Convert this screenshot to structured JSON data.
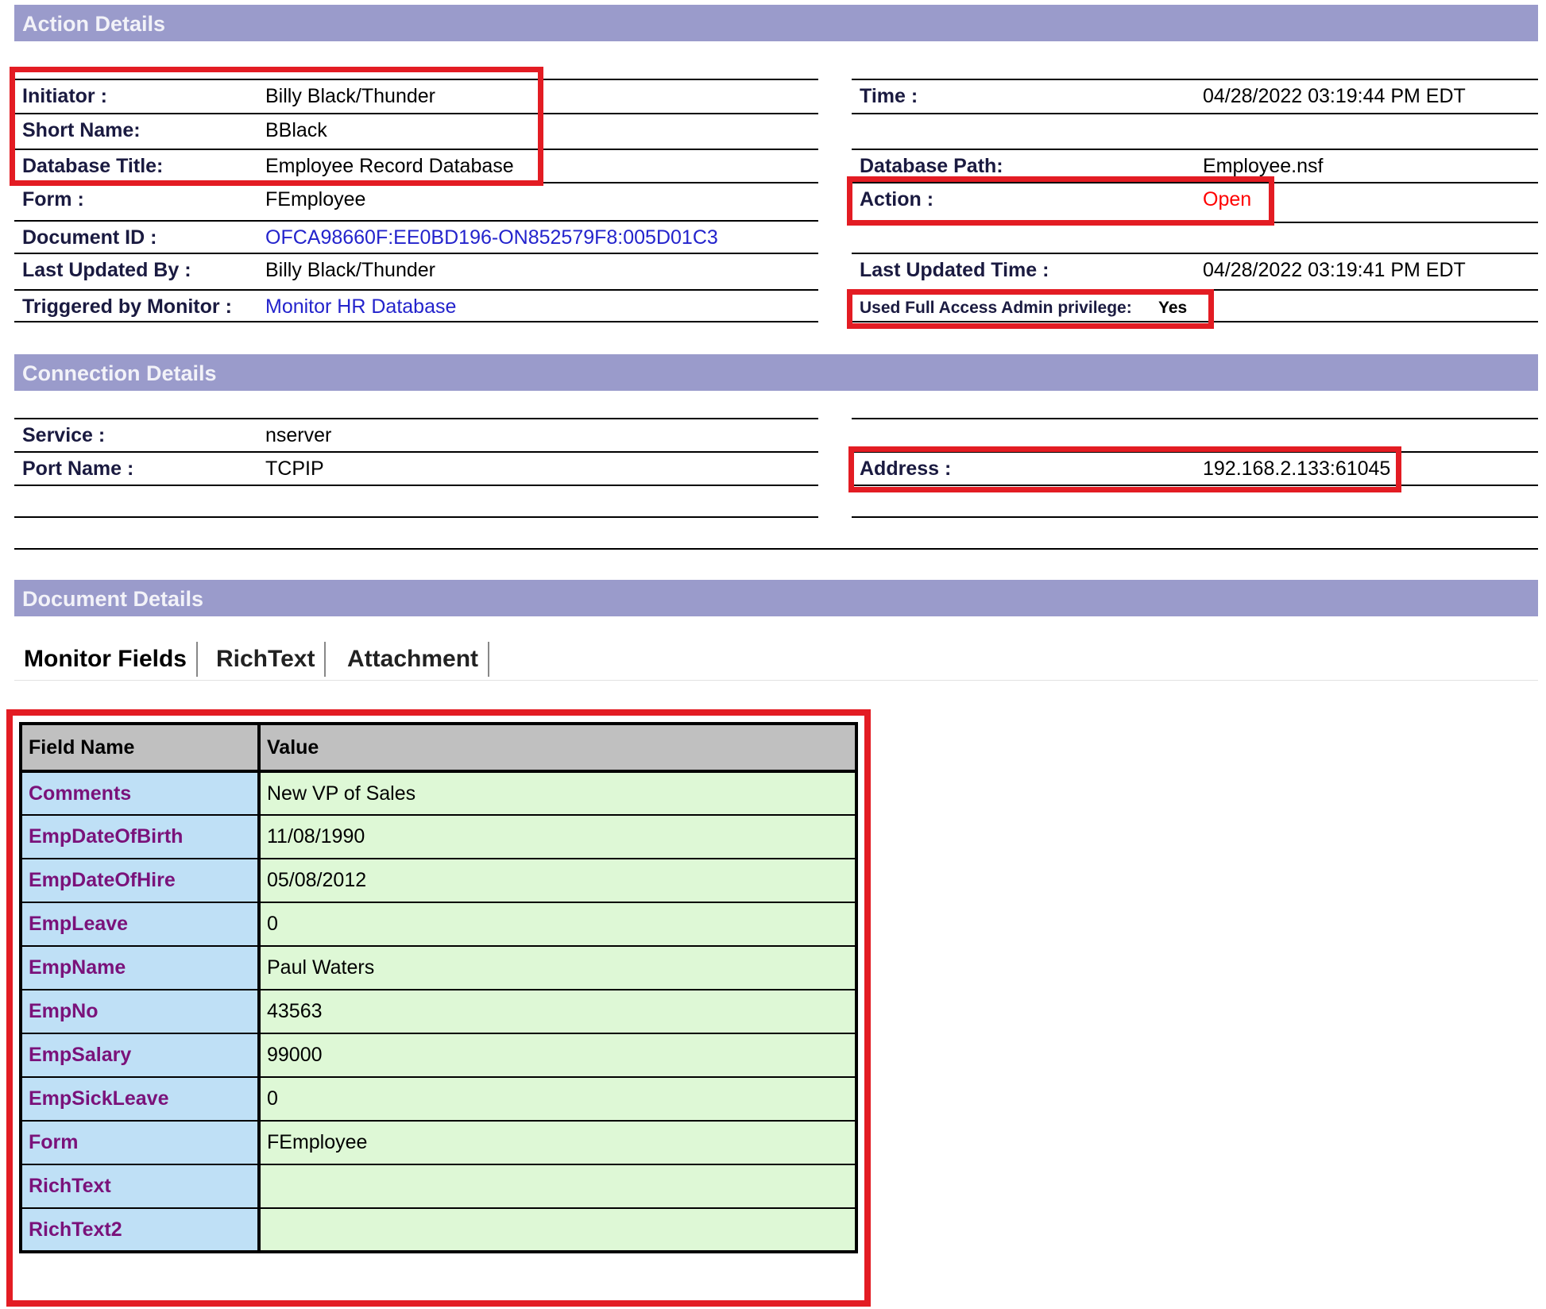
{
  "action_details": {
    "title": "Action Details",
    "initiator_label": "Initiator :",
    "initiator_value": "Billy Black/Thunder",
    "short_name_label": "Short Name:",
    "short_name_value": "BBlack",
    "db_title_label": "Database Title:",
    "db_title_value": "Employee Record Database",
    "form_label": "Form :",
    "form_value": "FEmployee",
    "doc_id_label": "Document ID :",
    "doc_id_value": "OFCA98660F:EE0BD196-ON852579F8:005D01C3",
    "last_updated_by_label": "Last Updated By :",
    "last_updated_by_value": "Billy Black/Thunder",
    "triggered_label": "Triggered by Monitor :",
    "triggered_value": "Monitor HR Database",
    "time_label": "Time :",
    "time_value": "04/28/2022 03:19:44 PM EDT",
    "db_path_label": "Database Path:",
    "db_path_value": "Employee.nsf",
    "action_label": "Action :",
    "action_value": "Open",
    "last_updated_time_label": "Last Updated Time :",
    "last_updated_time_value": "04/28/2022 03:19:41 PM EDT",
    "full_access_label": "Used Full Access Admin privilege:",
    "full_access_value": "Yes"
  },
  "connection_details": {
    "title": "Connection Details",
    "service_label": "Service :",
    "service_value": "nserver",
    "port_label": "Port Name :",
    "port_value": "TCPIP",
    "address_label": "Address :",
    "address_value": "192.168.2.133:61045"
  },
  "document_details": {
    "title": "Document Details",
    "tabs": [
      "Monitor Fields",
      "RichText",
      "Attachment"
    ],
    "table": {
      "headers": [
        "Field Name",
        "Value"
      ],
      "rows": [
        {
          "name": "Comments",
          "value": "New VP of Sales"
        },
        {
          "name": "EmpDateOfBirth",
          "value": "11/08/1990"
        },
        {
          "name": "EmpDateOfHire",
          "value": "05/08/2012"
        },
        {
          "name": "EmpLeave",
          "value": "0"
        },
        {
          "name": "EmpName",
          "value": "Paul Waters"
        },
        {
          "name": "EmpNo",
          "value": "43563"
        },
        {
          "name": "EmpSalary",
          "value": "99000"
        },
        {
          "name": "EmpSickLeave",
          "value": "0"
        },
        {
          "name": "Form",
          "value": "FEmployee"
        },
        {
          "name": "RichText",
          "value": ""
        },
        {
          "name": "RichText2",
          "value": ""
        }
      ]
    }
  },
  "colors": {
    "section_header": "#9a9bcb",
    "highlight_box": "#e31c23",
    "field_name_bg": "#bfe0f6",
    "field_value_bg": "#def8d6",
    "field_name_text": "#7a127a",
    "link_text": "#2323cc",
    "action_text": "#ff0000"
  }
}
